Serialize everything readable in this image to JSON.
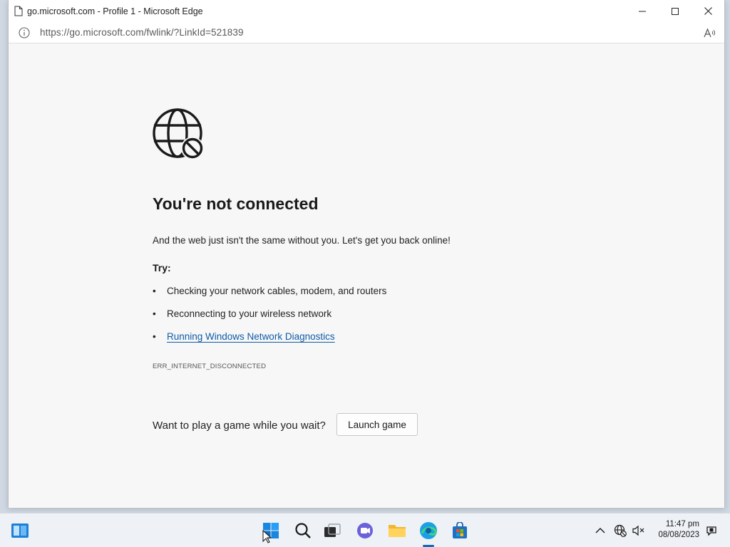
{
  "window": {
    "title": "go.microsoft.com - Profile 1 - Microsoft Edge"
  },
  "address_bar": {
    "url": "https://go.microsoft.com/fwlink/?LinkId=521839"
  },
  "error_page": {
    "heading": "You're not connected",
    "subtext": "And the web just isn't the same without you. Let's get you back online!",
    "try_label": "Try:",
    "suggestions": [
      "Checking your network cables, modem, and routers",
      "Reconnecting to your wireless network",
      "Running Windows Network Diagnostics"
    ],
    "error_code": "ERR_INTERNET_DISCONNECTED",
    "game_prompt": "Want to play a game while you wait?",
    "launch_game_label": "Launch game"
  },
  "taskbar": {
    "time": "11:47 pm",
    "date": "08/08/2023"
  },
  "colors": {
    "link": "#0f5ba7",
    "accent": "#0f6cbd"
  }
}
